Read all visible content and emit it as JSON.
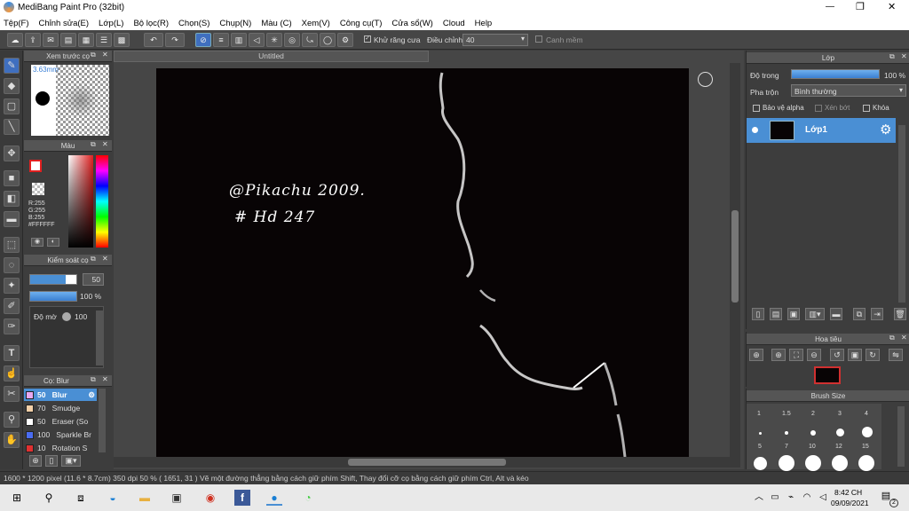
{
  "window": {
    "title": "MediBang Paint Pro (32bit)",
    "min": "—",
    "max": "❐",
    "close": "✕"
  },
  "menu": [
    "Tệp(F)",
    "Chỉnh sửa(E)",
    "Lớp(L)",
    "Bộ lọc(R)",
    "Chọn(S)",
    "Chụp(N)",
    "Màu (C)",
    "Xem(V)",
    "Công cụ(T)",
    "Cửa sổ(W)",
    "Cloud",
    "Help"
  ],
  "toolbar": {
    "antialias_label": "Khử răng cưa",
    "adjust_label": "Điều chỉnh",
    "adjust_value": "40",
    "snap_label": "Canh mềm"
  },
  "preview": {
    "title": "Xem trước cọ",
    "size": "3.63mm"
  },
  "color": {
    "title": "Màu",
    "r": "R:255",
    "g": "G:255",
    "b": "B:255",
    "hex": "#FFFFFF"
  },
  "control": {
    "title": "Kiểm soát cọ",
    "size": "50",
    "opacity": "100 %",
    "density_label": "Độ mờ",
    "density": "100"
  },
  "brush": {
    "title": "Cọ: Blur",
    "items": [
      {
        "size": "50",
        "name": "Blur",
        "color": "#e8a8f0",
        "selected": true
      },
      {
        "size": "70",
        "name": "Smudge",
        "color": "#f4d0a8",
        "selected": false
      },
      {
        "size": "50",
        "name": "Eraser (So",
        "color": "#ffffff",
        "selected": false
      },
      {
        "size": "100",
        "name": "Sparkle Br",
        "color": "#4a6cf0",
        "selected": false
      },
      {
        "size": "10",
        "name": "Rotation S",
        "color": "#e03030",
        "selected": false
      }
    ]
  },
  "canvas": {
    "tab": "Untitled",
    "signature_line1": "@Pikachu 2009.",
    "signature_line2": "# Hd 247"
  },
  "layers": {
    "title": "Lớp",
    "opacity_label": "Độ trong",
    "opacity_value": "100 %",
    "blend_label": "Pha trộn",
    "blend_value": "Bình thường",
    "protect_alpha": "Bảo vệ alpha",
    "clipping": "Xén bớt",
    "lock": "Khóa",
    "layer_name": "Lớp1"
  },
  "navigator": {
    "title": "Hoa tiêu"
  },
  "brushsize": {
    "title": "Brush Size",
    "sizes": [
      "1",
      "1.5",
      "2",
      "3",
      "4",
      "5",
      "7",
      "10",
      "12",
      "15"
    ]
  },
  "status": {
    "text": "1600 * 1200 pixel   (11.6 * 8.7cm)   350 dpi   50 %   ( 1651, 31 )   Vẽ một đường thẳng bằng cách giữ phím Shift, Thay đổi cỡ cọ bằng cách giữ phím Ctrl, Alt và kéo"
  },
  "taskbar": {
    "time": "8:42 CH",
    "date": "09/09/2021",
    "notif": "2"
  },
  "colors": {
    "accent": "#4a8fd4",
    "canvas": "#080405",
    "panel": "#3d3d3d"
  }
}
